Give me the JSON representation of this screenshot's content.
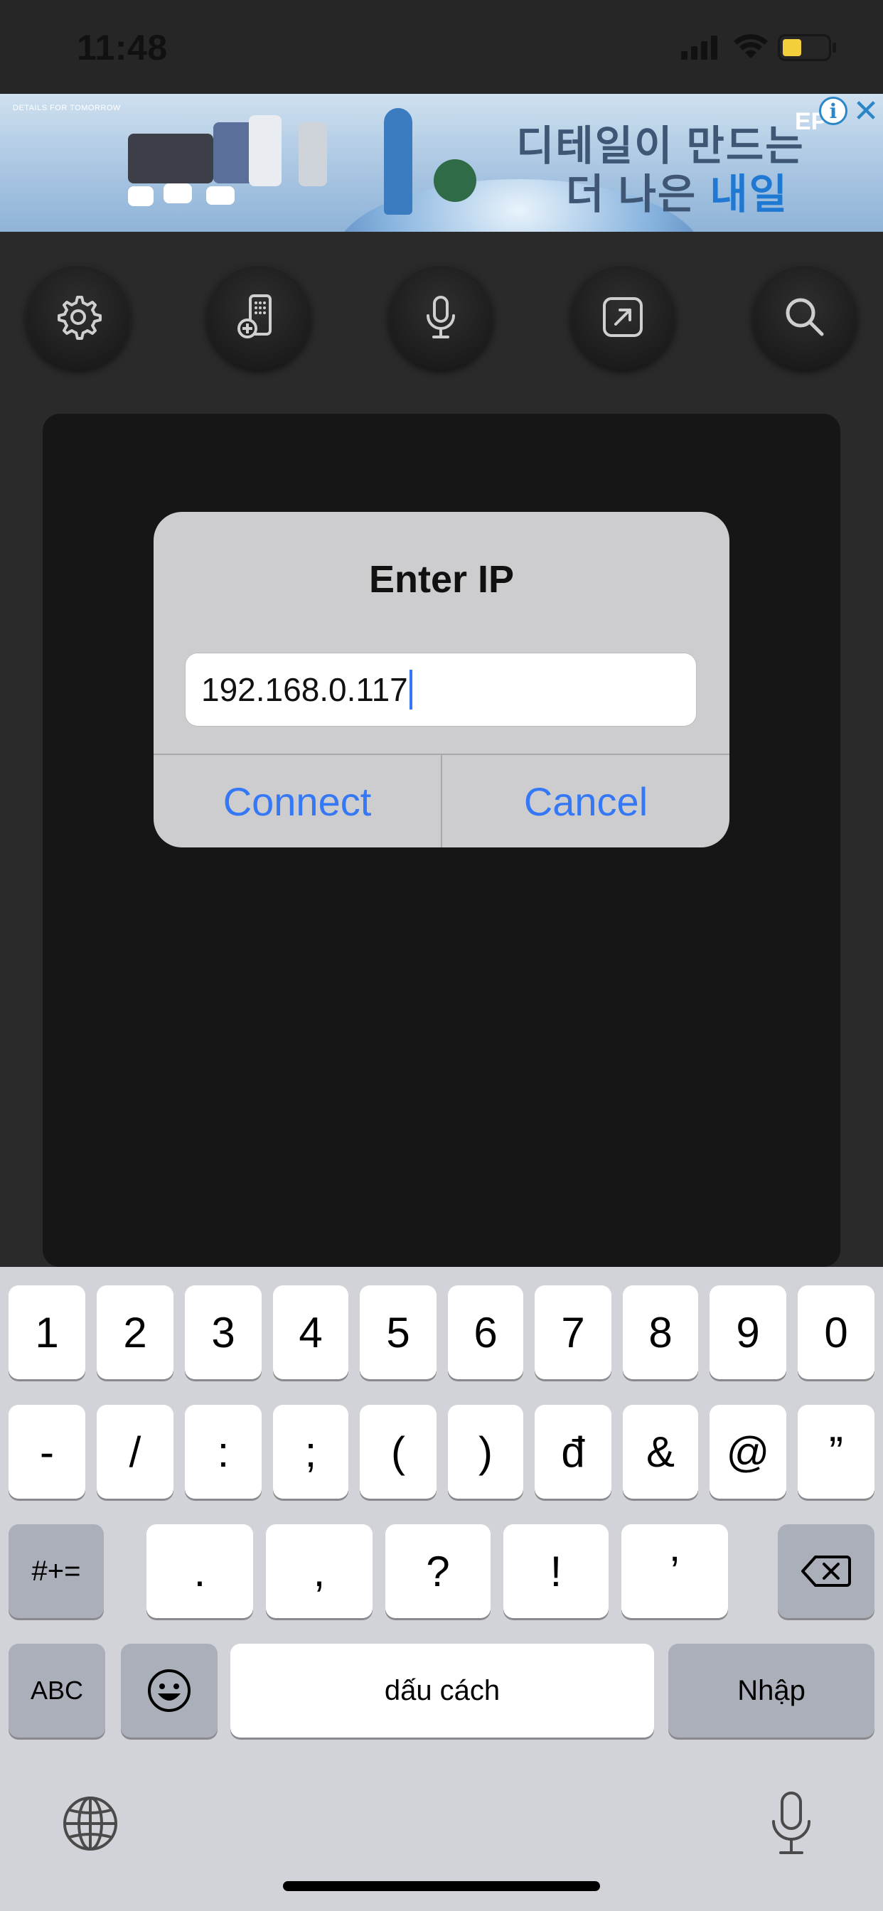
{
  "status_bar": {
    "time": "11:48"
  },
  "ad": {
    "tagline": "DETAILS FOR TOMORROW",
    "headline_line1": "디테일이 만드는",
    "headline_line2_prefix": "더 나은 ",
    "headline_line2_accent": "내일",
    "brand": "EP",
    "info_icon": "i",
    "close_icon": "✕"
  },
  "toolbar": {
    "items": [
      {
        "icon": "gear-icon"
      },
      {
        "icon": "add-device-icon"
      },
      {
        "icon": "microphone-icon"
      },
      {
        "icon": "open-external-icon"
      },
      {
        "icon": "search-icon"
      }
    ]
  },
  "alert": {
    "title": "Enter IP",
    "input_value": "192.168.0.117",
    "connect_label": "Connect",
    "cancel_label": "Cancel"
  },
  "keyboard": {
    "row1": [
      "1",
      "2",
      "3",
      "4",
      "5",
      "6",
      "7",
      "8",
      "9",
      "0"
    ],
    "row2": [
      "-",
      "/",
      ":",
      ";",
      "(",
      ")",
      "đ",
      "&",
      "@",
      "”"
    ],
    "row3": {
      "shift_label": "#+=",
      "keys": [
        ".",
        ",",
        "?",
        "!",
        "’"
      ]
    },
    "row4": {
      "abc_label": "ABC",
      "space_label": "dấu cách",
      "return_label": "Nhập"
    },
    "colors": {
      "key": "#ffffff",
      "dark_key": "#abafba",
      "background": "#d2d3d9"
    }
  },
  "colors": {
    "accent": "#3478f6",
    "alert_bg": "#cdcdcf",
    "panel_bg": "#161616"
  }
}
